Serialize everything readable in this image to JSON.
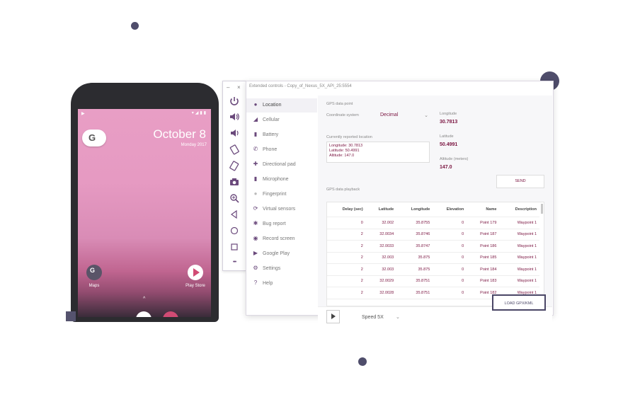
{
  "phone": {
    "date": "October 8",
    "date_sub": "Monday 2017",
    "google_letter": "G",
    "apps": [
      {
        "label": "Maps",
        "icon": "maps-icon"
      },
      {
        "label": "Play Store",
        "icon": "play-store-icon"
      }
    ],
    "swipe_hint": "^"
  },
  "toolbar": {
    "minimize": "–",
    "close": "×",
    "more": "•••",
    "buttons": [
      "power-icon",
      "volume-up-icon",
      "volume-down-icon",
      "rotate-left-icon",
      "rotate-right-icon",
      "camera-icon",
      "zoom-icon",
      "back-icon",
      "home-icon",
      "overview-icon",
      "more-icon"
    ]
  },
  "ext": {
    "title": "Extended controls - Copy_of_Nexus_5X_API_25:5554",
    "nav": [
      {
        "label": "Location",
        "icon": "location-icon",
        "active": true
      },
      {
        "label": "Cellular",
        "icon": "cellular-icon"
      },
      {
        "label": "Battery",
        "icon": "battery-icon"
      },
      {
        "label": "Phone",
        "icon": "phone-icon"
      },
      {
        "label": "Directional pad",
        "icon": "dpad-icon"
      },
      {
        "label": "Microphone",
        "icon": "microphone-icon"
      },
      {
        "label": "Fingerprint",
        "icon": "fingerprint-icon"
      },
      {
        "label": "Virtual sensors",
        "icon": "sensors-icon"
      },
      {
        "label": "Bug report",
        "icon": "bug-icon"
      },
      {
        "label": "Record screen",
        "icon": "record-icon"
      },
      {
        "label": "Google Play",
        "icon": "google-play-icon"
      },
      {
        "label": "Settings",
        "icon": "settings-icon"
      },
      {
        "label": "Help",
        "icon": "help-icon"
      }
    ],
    "gps_point_label": "GPS data point",
    "coord_system_label": "Coordinate system",
    "coord_system_value": "Decimal",
    "current_loc_label": "Currently reported location",
    "current_loc_lines": [
      "Longitude: 30.7813",
      "Latitude: 50.4991",
      "Altitude: 147.0"
    ],
    "longitude_label": "Longitude",
    "longitude_value": "30.7813",
    "latitude_label": "Latitude",
    "latitude_value": "50.4991",
    "altitude_label": "Altitude (meters)",
    "altitude_value": "147.0",
    "send_label": "SEND",
    "playback_label": "GPS data playback",
    "table": {
      "headers": [
        "Delay (sec)",
        "Latitude",
        "Longitude",
        "Elevation",
        "Name",
        "Description"
      ],
      "rows": [
        [
          "0",
          "32.002",
          "35.8755",
          "0",
          "Point 179",
          "Waypoint 1"
        ],
        [
          "2",
          "32.0034",
          "35.8746",
          "0",
          "Point 187",
          "Waypoint 1"
        ],
        [
          "2",
          "32.0033",
          "35.8747",
          "0",
          "Point 186",
          "Waypoint 1"
        ],
        [
          "2",
          "32.003",
          "35.875",
          "0",
          "Point 185",
          "Waypoint 1"
        ],
        [
          "2",
          "32.003",
          "35.875",
          "0",
          "Point 184",
          "Waypoint 1"
        ],
        [
          "2",
          "32.0029",
          "35.8751",
          "0",
          "Point 183",
          "Waypoint 1"
        ],
        [
          "2",
          "32.0028",
          "35.8751",
          "0",
          "Point 182",
          "Waypoint 1"
        ]
      ]
    },
    "speed_label": "Speed 5X",
    "load_label": "LOAD GPX/KML"
  }
}
